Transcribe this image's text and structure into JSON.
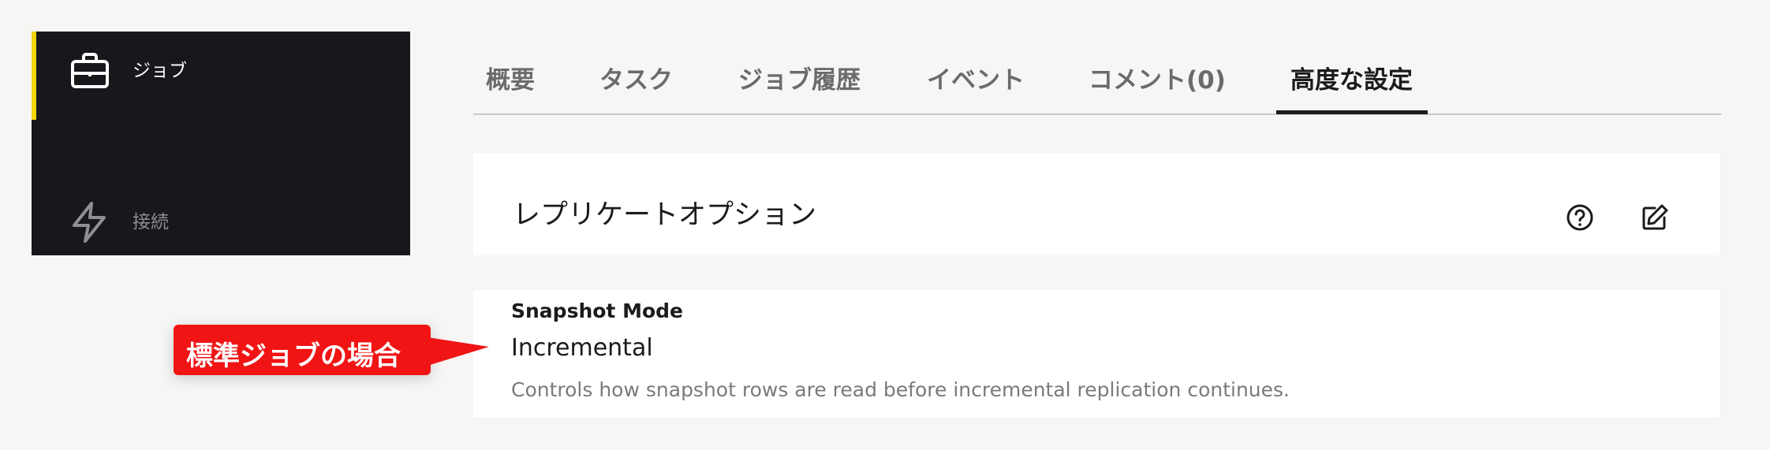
{
  "sidebar": {
    "items": [
      {
        "label": "ジョブ",
        "icon": "briefcase-icon",
        "active": true
      },
      {
        "label": "接続",
        "icon": "lightning-icon",
        "active": false
      }
    ],
    "accent_color": "#f2d600"
  },
  "tabs": [
    {
      "label": "概要"
    },
    {
      "label": "タスク"
    },
    {
      "label": "ジョブ履歴"
    },
    {
      "label": "イベント"
    },
    {
      "label": "コメント(0)"
    },
    {
      "label": "高度な設定",
      "active": true
    }
  ],
  "section": {
    "title": "レプリケートオプション",
    "help_icon": "help-circle-icon",
    "edit_icon": "edit-icon"
  },
  "field": {
    "label": "Snapshot Mode",
    "value": "Incremental",
    "description": "Controls how snapshot rows are read before incremental replication continues."
  },
  "callout": {
    "text": "標準ジョブの場合",
    "color": "#f01414"
  }
}
